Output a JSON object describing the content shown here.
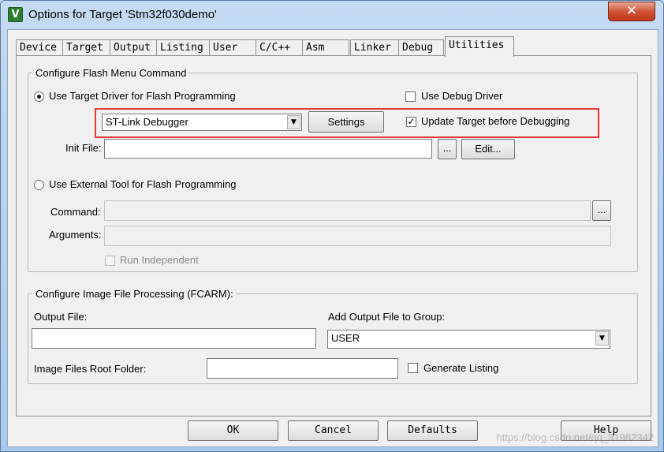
{
  "window": {
    "title": "Options for Target 'Stm32f030demo'",
    "app_icon_glyph": "V",
    "close_glyph": "✕"
  },
  "tabs": [
    {
      "label": "Device"
    },
    {
      "label": "Target"
    },
    {
      "label": "Output"
    },
    {
      "label": "Listing"
    },
    {
      "label": "User"
    },
    {
      "label": "C/C++"
    },
    {
      "label": "Asm"
    },
    {
      "label": "Linker"
    },
    {
      "label": "Debug"
    },
    {
      "label": "Utilities"
    }
  ],
  "active_tab": "Utilities",
  "flash_group": {
    "legend": "Configure Flash Menu Command",
    "use_target_driver_label": "Use Target Driver for Flash Programming",
    "use_target_driver_checked": true,
    "use_debug_driver_label": "Use Debug Driver",
    "use_debug_driver_checked": false,
    "driver_select_value": "ST-Link Debugger",
    "settings_button": "Settings",
    "update_target_label": "Update Target before Debugging",
    "update_target_checked": true,
    "update_target_check_glyph": "✓",
    "init_file_label": "Init File:",
    "init_file_value": "",
    "browse_button": "...",
    "edit_button": "Edit...",
    "use_external_tool_label": "Use External Tool for Flash Programming",
    "use_external_tool_checked": false,
    "command_label": "Command:",
    "command_browse": "...",
    "arguments_label": "Arguments:",
    "run_independent_label": "Run Independent"
  },
  "image_group": {
    "legend": "Configure Image File Processing (FCARM):",
    "output_file_label": "Output File:",
    "output_file_value": "",
    "add_output_label": "Add Output File  to Group:",
    "group_select_value": "USER",
    "root_folder_label": "Image Files Root Folder:",
    "root_folder_value": "",
    "generate_listing_label": "Generate Listing",
    "generate_listing_checked": false
  },
  "footer": {
    "ok": "OK",
    "cancel": "Cancel",
    "defaults": "Defaults",
    "help": "Help"
  },
  "watermark": "https://blog.csdn.net/qq_31982342",
  "colors": {
    "highlight_box": "#e53935",
    "close_button": "#cf4e31"
  }
}
